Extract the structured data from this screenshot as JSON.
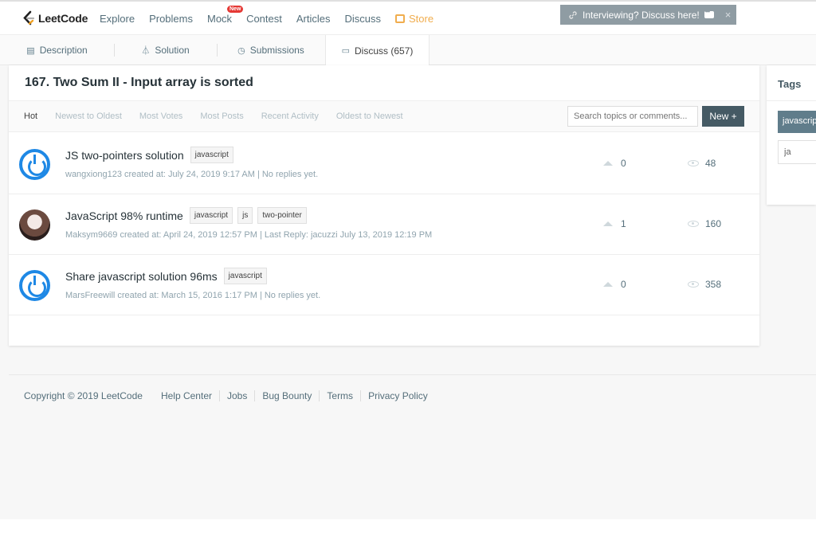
{
  "nav": {
    "logo": "LeetCode",
    "items": [
      "Explore",
      "Problems",
      "Mock",
      "Contest",
      "Articles",
      "Discuss"
    ],
    "mock_badge": "New",
    "store": "Store",
    "interview_banner": "Interviewing? Discuss here!",
    "close_glyph": "×"
  },
  "tabs": [
    {
      "icon": "document-icon",
      "label": "Description"
    },
    {
      "icon": "flask-icon",
      "label": "Solution"
    },
    {
      "icon": "clock-icon",
      "label": "Submissions"
    },
    {
      "icon": "comment-icon",
      "label": "Discuss (657)"
    }
  ],
  "page": {
    "title": "167. Two Sum II - Input array is sorted"
  },
  "filters": [
    "Hot",
    "Newest to Oldest",
    "Most Votes",
    "Most Posts",
    "Recent Activity",
    "Oldest to Newest"
  ],
  "search": {
    "placeholder": "Search topics or comments..."
  },
  "new_button": "New +",
  "posts": [
    {
      "title": "JS two-pointers solution",
      "tags": [
        "javascript"
      ],
      "meta": "wangxiong123 created at: July 24, 2019 9:17 AM | No replies yet.",
      "votes": "0",
      "views": "48",
      "avatar": "power-icon"
    },
    {
      "title": "JavaScript 98% runtime",
      "tags": [
        "javascript",
        "js",
        "two-pointer"
      ],
      "meta": "Maksym9669 created at: April 24, 2019 12:57 PM | Last Reply: jacuzzi July 13, 2019 12:19 PM",
      "votes": "1",
      "views": "160",
      "avatar": "user-photo"
    },
    {
      "title": "Share javascript solution 96ms",
      "tags": [
        "javascript"
      ],
      "meta": "MarsFreewill created at: March 15, 2016 1:17 PM | No replies yet.",
      "votes": "0",
      "views": "358",
      "avatar": "power-icon"
    }
  ],
  "side": {
    "title": "Tags",
    "selected_tag": "javascript",
    "input_value": "ja"
  },
  "footer": {
    "copyright": "Copyright © 2019 LeetCode",
    "links": [
      "Help Center",
      "Jobs",
      "Bug Bounty",
      "Terms",
      "Privacy Policy"
    ]
  },
  "colors": {
    "accent": "#455a64",
    "store": "#f0ad4e",
    "badge": "#e53935",
    "avatar_blue": "#1e88e5"
  }
}
